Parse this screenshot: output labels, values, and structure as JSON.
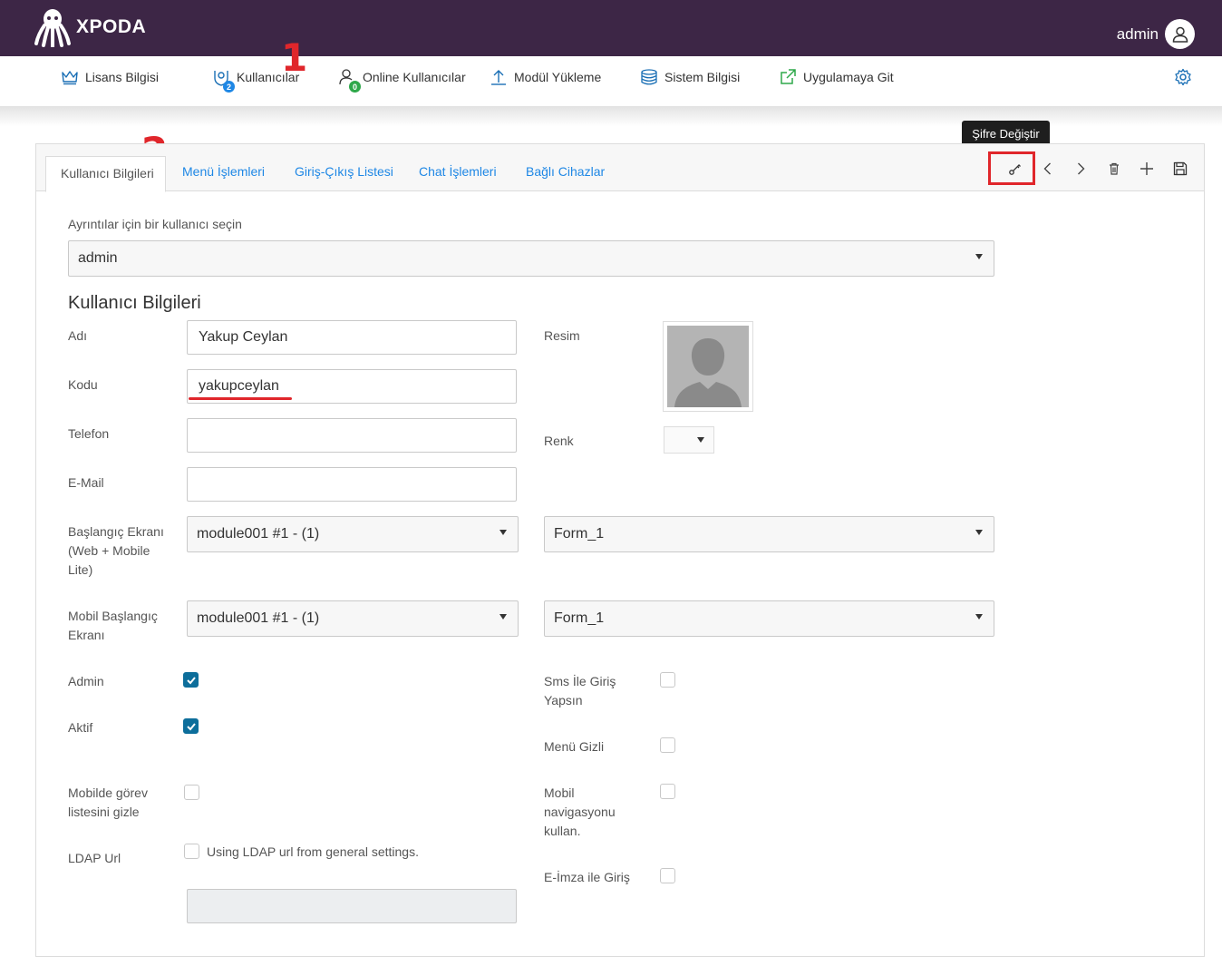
{
  "header": {
    "logo_text": "XPODA",
    "user_name": "admin"
  },
  "nav": {
    "items": [
      {
        "label": "Lisans Bilgisi",
        "icon": "crown-icon"
      },
      {
        "label": "Kullanıcılar",
        "icon": "users-icon",
        "badge": "2"
      },
      {
        "label": "Online Kullanıcılar",
        "icon": "online-user-icon",
        "badge": "0"
      },
      {
        "label": "Modül Yükleme",
        "icon": "upload-icon"
      },
      {
        "label": "Sistem Bilgisi",
        "icon": "database-icon"
      },
      {
        "label": "Uygulamaya Git",
        "icon": "external-link-icon"
      }
    ],
    "colors": {
      "badge_blue": "#1e87e5",
      "badge_green": "#2ea84a",
      "gear": "#1a6fb5"
    }
  },
  "annotations": {
    "marker1": "1",
    "marker2": "2"
  },
  "tabs": [
    {
      "label": "Kullanıcı Bilgileri",
      "active": true
    },
    {
      "label": "Menü İşlemleri"
    },
    {
      "label": "Giriş-Çıkış Listesi"
    },
    {
      "label": "Chat İşlemleri"
    },
    {
      "label": "Bağlı Cihazlar"
    }
  ],
  "toolbar": {
    "tooltip": "Şifre Değiştir",
    "buttons": [
      "key-icon",
      "chevron-left-icon",
      "chevron-right-icon",
      "trash-icon",
      "plus-icon",
      "save-icon"
    ]
  },
  "form": {
    "select_user_label": "Ayrıntılar için bir kullanıcı seçin",
    "selected_user": "admin",
    "section_title": "Kullanıcı Bilgileri",
    "adi_label": "Adı",
    "adi_value": "Yakup Ceylan",
    "kodu_label": "Kodu",
    "kodu_value": "yakupceylan",
    "telefon_label": "Telefon",
    "telefon_value": "",
    "email_label": "E-Mail",
    "email_value": "",
    "resim_label": "Resim",
    "renk_label": "Renk",
    "start_label": "Başlangıç Ekranı (Web + Mobile Lite)",
    "start_module": "module001 #1 - (1)",
    "start_form": "Form_1",
    "mobile_start_label": "Mobil Başlangıç Ekranı",
    "mobile_start_module": "module001 #1 - (1)",
    "mobile_start_form": "Form_1",
    "admin_label": "Admin",
    "admin_checked": true,
    "aktif_label": "Aktif",
    "aktif_checked": true,
    "mobile_task_label": "Mobilde görev listesini gizle",
    "mobile_task_checked": false,
    "ldap_label": "LDAP Url",
    "ldap_checkbox_text": "Using LDAP url from general settings.",
    "ldap_checked": false,
    "ldap_value": "",
    "sms_label": "Sms İle Giriş Yapsın",
    "sms_checked": false,
    "menu_hidden_label": "Menü Gizli",
    "menu_hidden_checked": false,
    "mobile_nav_label": "Mobil navigasyonu kullan.",
    "mobile_nav_checked": false,
    "eimza_label": "E-İmza ile Giriş",
    "eimza_checked": false
  }
}
